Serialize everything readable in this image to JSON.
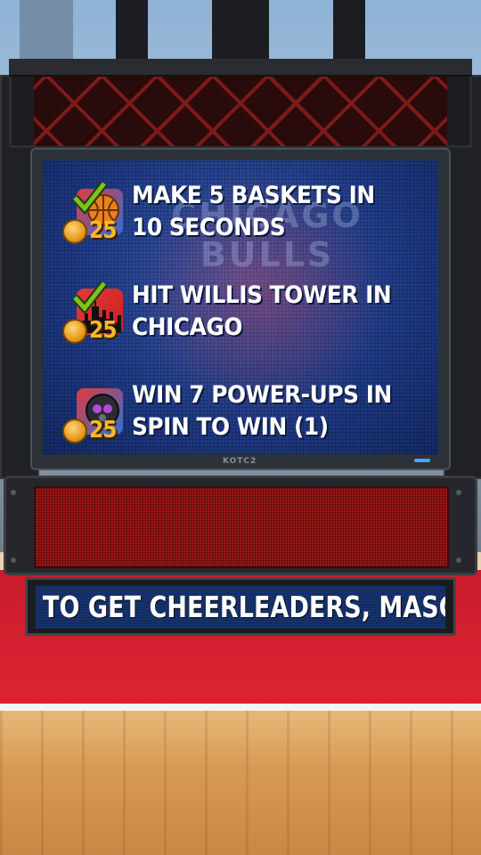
{
  "missions": [
    {
      "title": "MAKE 5 BASKETS IN 10 SECONDS",
      "reward": "25",
      "icon": "basketball-check-icon",
      "completed": true
    },
    {
      "title": "HIT WILLIS TOWER IN CHICAGO",
      "reward": "25",
      "icon": "chicago-skyline-check-icon",
      "completed": true
    },
    {
      "title": "WIN 7 POWER-UPS IN SPIN TO WIN (1)",
      "reward": "25",
      "icon": "spin-to-win-icon",
      "completed": false
    }
  ],
  "screen": {
    "watermark": "CHICAGO BULLS",
    "brand": "KOTC2"
  },
  "ticker": {
    "text": "TO GET CHEERLEADERS, MASCOTS"
  },
  "colors": {
    "screen_blue": "#1f3a86",
    "reward_gold": "#f7b928",
    "court_red": "#de2333",
    "check_green": "#7fc21e"
  }
}
